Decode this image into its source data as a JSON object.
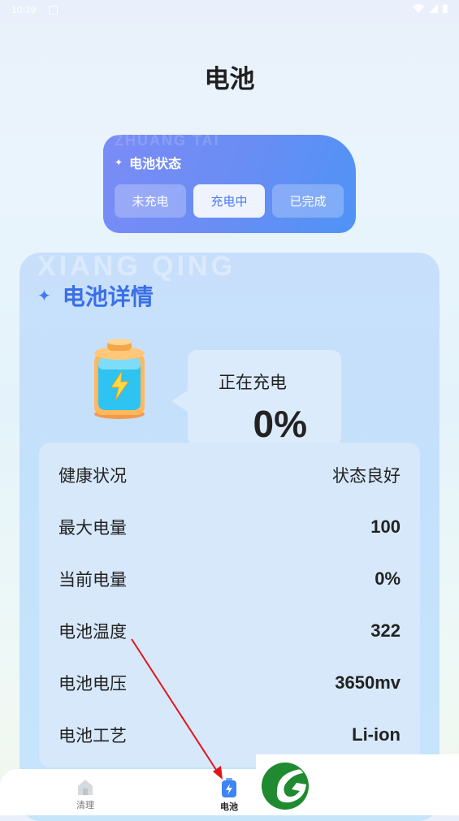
{
  "status_bar": {
    "time": "10:39"
  },
  "page": {
    "title": "电池"
  },
  "status_card": {
    "watermark": "ZHUANG TAI",
    "title": "电池状态",
    "segments": [
      {
        "label": "未充电",
        "active": false
      },
      {
        "label": "充电中",
        "active": true
      },
      {
        "label": "已完成",
        "active": false
      }
    ]
  },
  "detail": {
    "watermark": "XIANG QING",
    "title": "电池详情",
    "charging_label": "正在充电",
    "percent": "0%",
    "rows": [
      {
        "label": "健康状况",
        "value": "状态良好"
      },
      {
        "label": "最大电量",
        "value": "100"
      },
      {
        "label": "当前电量",
        "value": "0%"
      },
      {
        "label": "电池温度",
        "value": "322"
      },
      {
        "label": "电池电压",
        "value": "3650mv"
      },
      {
        "label": "电池工艺",
        "value": "Li-ion"
      }
    ]
  },
  "nav": {
    "items": [
      {
        "label": "清理",
        "icon": "home-icon",
        "active": false
      },
      {
        "label": "电池",
        "icon": "battery-icon",
        "active": true
      }
    ]
  },
  "colors": {
    "accent": "#3a6fe8",
    "card_gradient_start": "#7b8cf6",
    "card_gradient_end": "#4f93f6",
    "annotation": "#e0161a",
    "logo_green": "#1f8a2f"
  }
}
